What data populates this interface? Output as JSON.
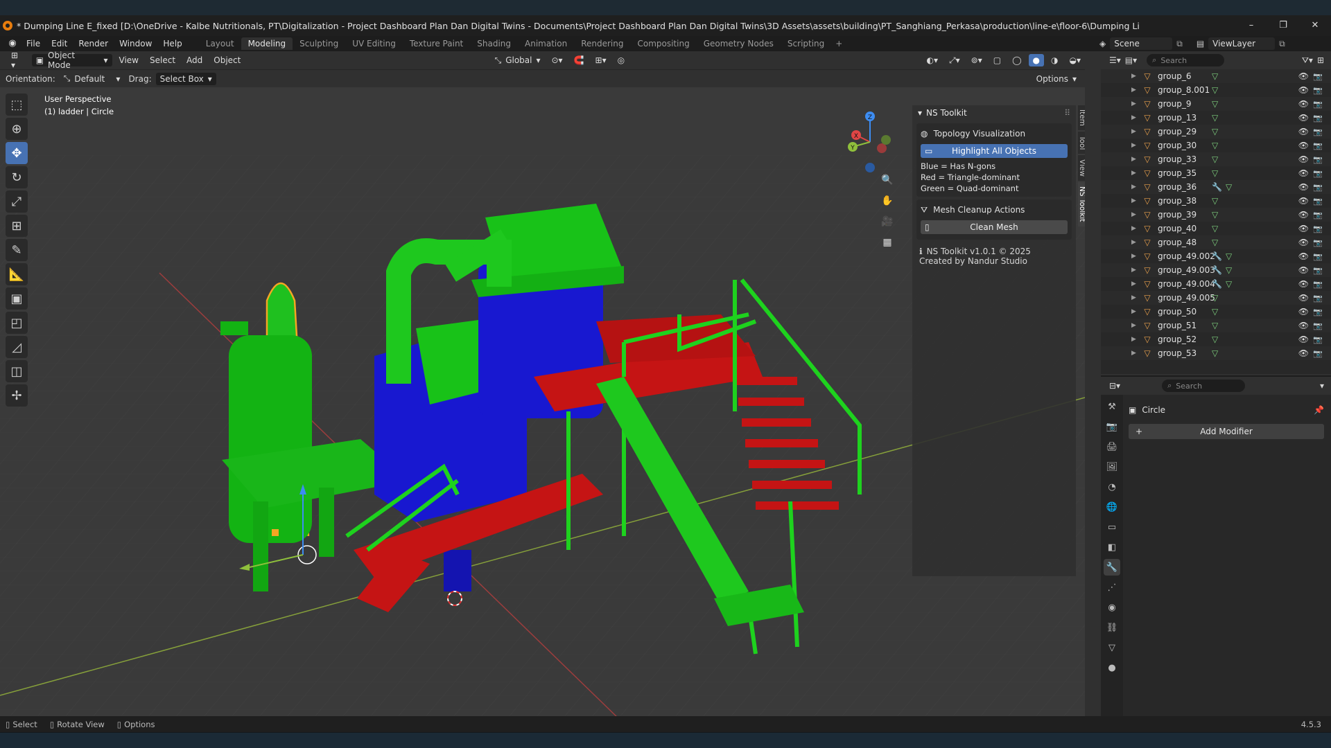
{
  "window": {
    "title": "* Dumping Line E_fixed [D:\\OneDrive - Kalbe Nutritionals, PT\\Digitalization - Project Dashboard Plan Dan Digital Twins - Documents\\Project Dashboard Plan Dan Digital Twins\\3D Assets\\assets\\building\\PT_Sanghiang_Perkasa\\production\\line-e\\floor-6\\Dumping Li",
    "controls": [
      "–",
      "❐",
      "✕"
    ]
  },
  "menu": [
    "File",
    "Edit",
    "Render",
    "Window",
    "Help"
  ],
  "workspaces": [
    "Layout",
    "Modeling",
    "Sculpting",
    "UV Editing",
    "Texture Paint",
    "Shading",
    "Animation",
    "Rendering",
    "Compositing",
    "Geometry Nodes",
    "Scripting"
  ],
  "active_workspace": "Modeling",
  "scene": {
    "label": "Scene",
    "view_layer": "ViewLayer"
  },
  "viewport_header": {
    "mode": "Object Mode",
    "menus": [
      "View",
      "Select",
      "Add",
      "Object"
    ],
    "transform": "Global"
  },
  "tool_header": {
    "orientation_label": "Orientation:",
    "orientation_value": "Default",
    "drag_label": "Drag:",
    "drag_value": "Select Box",
    "options": "Options"
  },
  "viewport_info": {
    "perspective": "User Perspective",
    "selection": "(1) ladder | Circle"
  },
  "gizmo_axes": [
    "Z",
    "X",
    "Y"
  ],
  "npanel": {
    "title": "NS Toolkit",
    "topology_title": "Topology Visualization",
    "highlight_btn": "Highlight All Objects",
    "legend": [
      "Blue = Has N-gons",
      "Red = Triangle-dominant",
      "Green = Quad-dominant"
    ],
    "cleanup_title": "Mesh Cleanup Actions",
    "clean_btn": "Clean Mesh",
    "version": "NS Toolkit v1.0.1 © 2025",
    "credit": "Created by Nandur Studio",
    "tabs": [
      "Item",
      "Tool",
      "View",
      "NS Toolkit"
    ]
  },
  "outliner": {
    "search_placeholder": "Search",
    "items": [
      {
        "name": "group_6",
        "modifier": false
      },
      {
        "name": "group_8.001",
        "modifier": false
      },
      {
        "name": "group_9",
        "modifier": false
      },
      {
        "name": "group_13",
        "modifier": false
      },
      {
        "name": "group_29",
        "modifier": false
      },
      {
        "name": "group_30",
        "modifier": false
      },
      {
        "name": "group_33",
        "modifier": false
      },
      {
        "name": "group_35",
        "modifier": false
      },
      {
        "name": "group_36",
        "modifier": true
      },
      {
        "name": "group_38",
        "modifier": false
      },
      {
        "name": "group_39",
        "modifier": false
      },
      {
        "name": "group_40",
        "modifier": false
      },
      {
        "name": "group_48",
        "modifier": false
      },
      {
        "name": "group_49.002",
        "modifier": true
      },
      {
        "name": "group_49.003",
        "modifier": true
      },
      {
        "name": "group_49.004",
        "modifier": true
      },
      {
        "name": "group_49.005",
        "modifier": false
      },
      {
        "name": "group_50",
        "modifier": false
      },
      {
        "name": "group_51",
        "modifier": false
      },
      {
        "name": "group_52",
        "modifier": false
      },
      {
        "name": "group_53",
        "modifier": false
      }
    ]
  },
  "properties": {
    "search_placeholder": "Search",
    "object_name": "Circle",
    "add_modifier": "Add Modifier"
  },
  "statusbar": {
    "select": "Select",
    "rotate": "Rotate View",
    "options": "Options",
    "version": "4.5.3"
  },
  "colors": {
    "accent": "#4772b3",
    "ngon_blue": "#1a1ad6",
    "tri_red": "#c81414",
    "quad_green": "#10c010",
    "selection": "#f5a623"
  }
}
